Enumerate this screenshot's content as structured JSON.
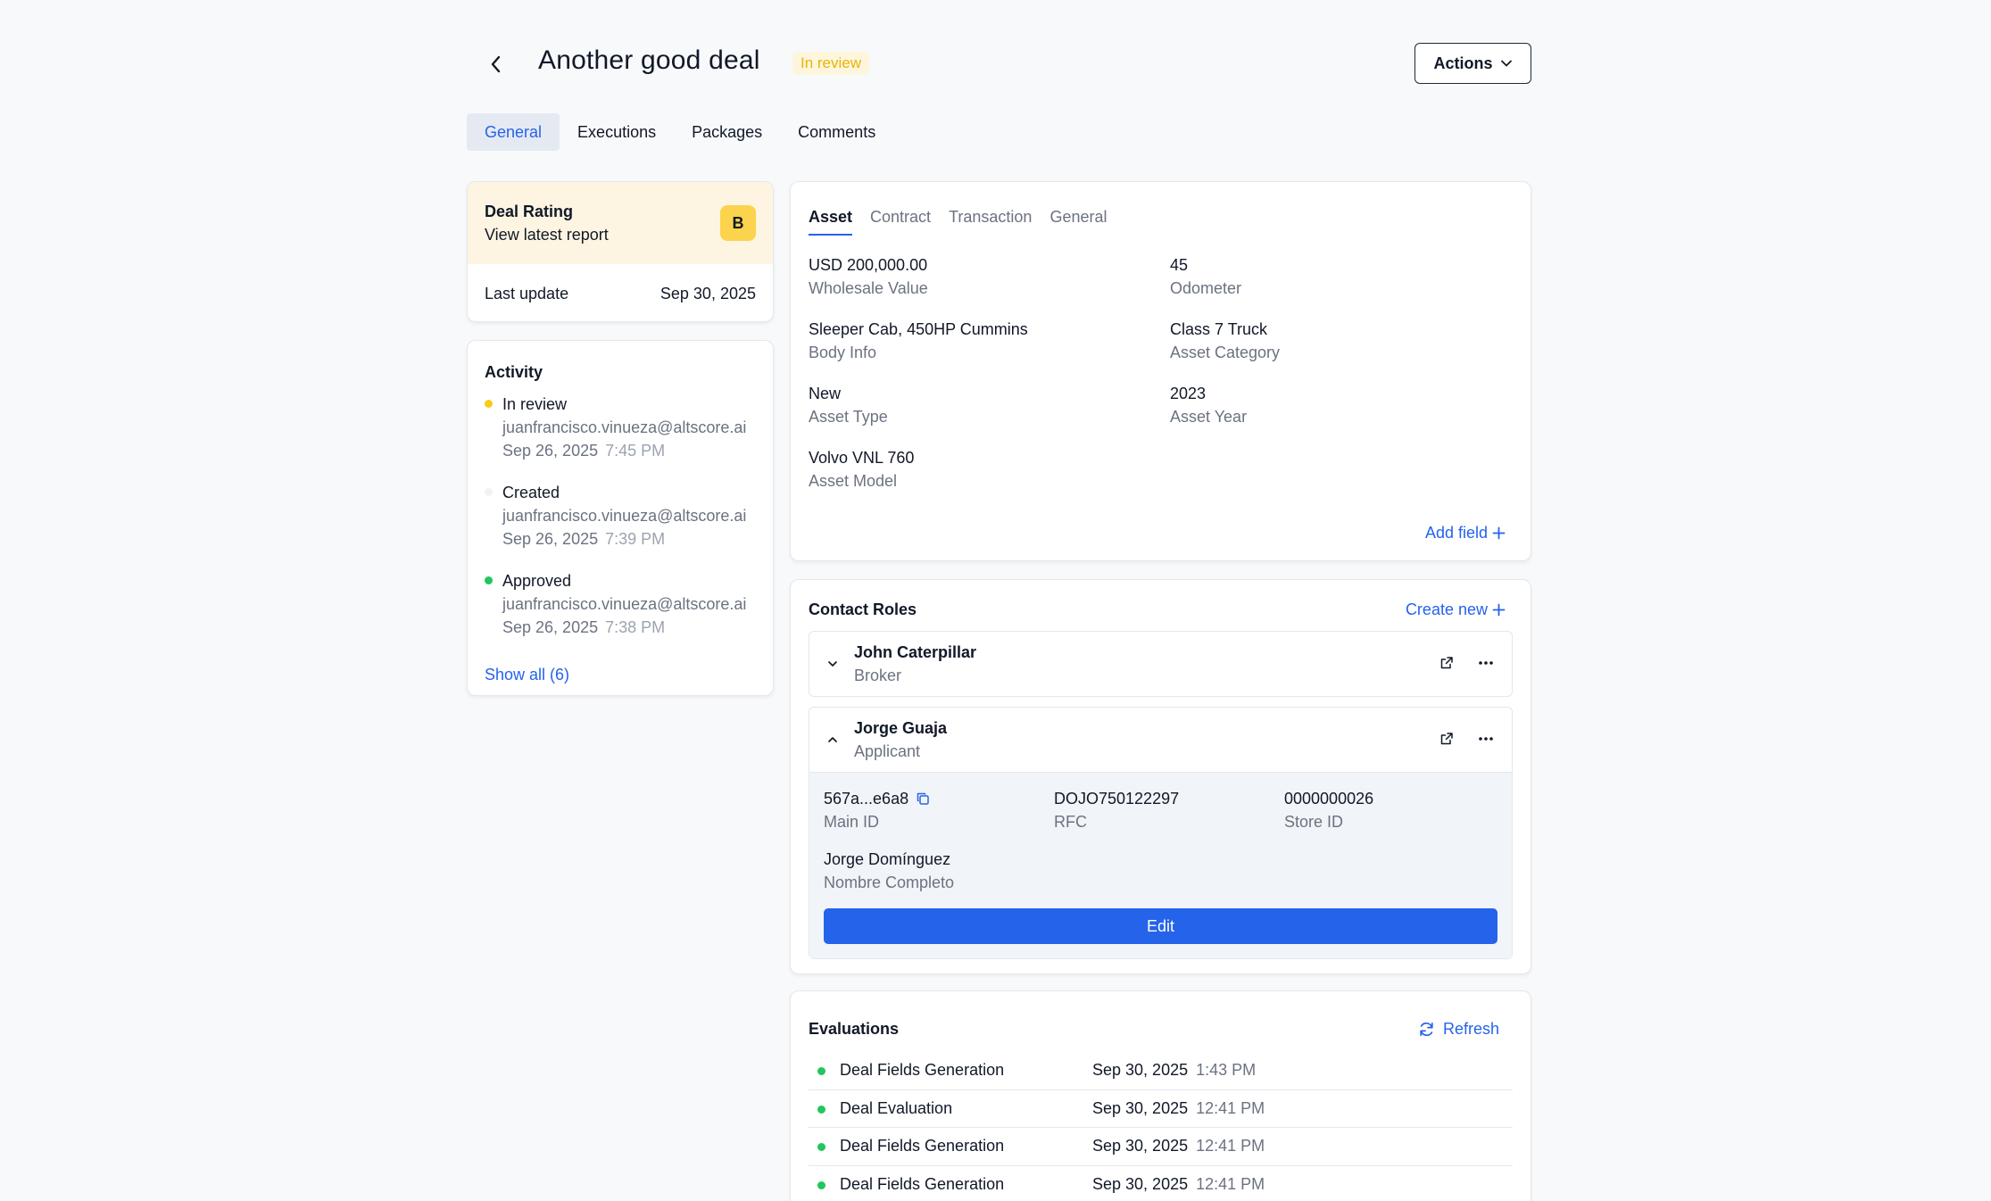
{
  "header": {
    "title": "Another good deal",
    "status": "In review",
    "actions_label": "Actions"
  },
  "tabs": [
    {
      "label": "General",
      "active": true
    },
    {
      "label": "Executions",
      "active": false
    },
    {
      "label": "Packages",
      "active": false
    },
    {
      "label": "Comments",
      "active": false
    }
  ],
  "rating": {
    "title": "Deal Rating",
    "link": "View latest report",
    "grade": "B",
    "last_update_label": "Last update",
    "last_update_value": "Sep 30, 2025"
  },
  "activity": {
    "title": "Activity",
    "items": [
      {
        "status": "In review",
        "email": "juanfrancisco.vinueza@altscore.ai",
        "date": "Sep 26, 2025",
        "time": "7:45 PM",
        "dot_color": "#facc15"
      },
      {
        "status": "Created",
        "email": "juanfrancisco.vinueza@altscore.ai",
        "date": "Sep 26, 2025",
        "time": "7:39 PM",
        "dot_color": "#f1f2f4"
      },
      {
        "status": "Approved",
        "email": "juanfrancisco.vinueza@altscore.ai",
        "date": "Sep 26, 2025",
        "time": "7:38 PM",
        "dot_color": "#22c55e"
      }
    ],
    "show_all": "Show all (6)"
  },
  "asset": {
    "tabs": [
      {
        "label": "Asset",
        "active": true
      },
      {
        "label": "Contract",
        "active": false
      },
      {
        "label": "Transaction",
        "active": false
      },
      {
        "label": "General",
        "active": false
      }
    ],
    "fields": [
      {
        "value": "USD 200,000.00",
        "label": "Wholesale Value"
      },
      {
        "value": "45",
        "label": "Odometer"
      },
      {
        "value": "Sleeper Cab, 450HP Cummins",
        "label": "Body Info"
      },
      {
        "value": "Class 7 Truck",
        "label": "Asset Category"
      },
      {
        "value": "New",
        "label": "Asset Type"
      },
      {
        "value": "2023",
        "label": "Asset Year"
      },
      {
        "value": "Volvo VNL 760",
        "label": "Asset Model"
      }
    ],
    "add_field": "Add field"
  },
  "contacts": {
    "title": "Contact Roles",
    "create_new": "Create new",
    "items": [
      {
        "name": "John Caterpillar",
        "role": "Broker",
        "expanded": false
      },
      {
        "name": "Jorge Guaja",
        "role": "Applicant",
        "expanded": true
      }
    ],
    "details": {
      "main_id_value": "567a...e6a8",
      "main_id_label": "Main ID",
      "rfc_value": "DOJO750122297",
      "rfc_label": "RFC",
      "store_id_value": "0000000026",
      "store_id_label": "Store ID",
      "full_name_value": "Jorge Domínguez",
      "full_name_label": "Nombre Completo"
    },
    "edit_label": "Edit"
  },
  "evaluations": {
    "title": "Evaluations",
    "refresh": "Refresh",
    "items": [
      {
        "name": "Deal Fields Generation",
        "date": "Sep 30, 2025",
        "time": "1:43 PM"
      },
      {
        "name": "Deal Evaluation",
        "date": "Sep 30, 2025",
        "time": "12:41 PM"
      },
      {
        "name": "Deal Fields Generation",
        "date": "Sep 30, 2025",
        "time": "12:41 PM"
      },
      {
        "name": "Deal Fields Generation",
        "date": "Sep 30, 2025",
        "time": "12:41 PM"
      }
    ]
  },
  "colors": {
    "accent": "#2563eb",
    "pending": "#facc15",
    "success": "#22c55e"
  }
}
